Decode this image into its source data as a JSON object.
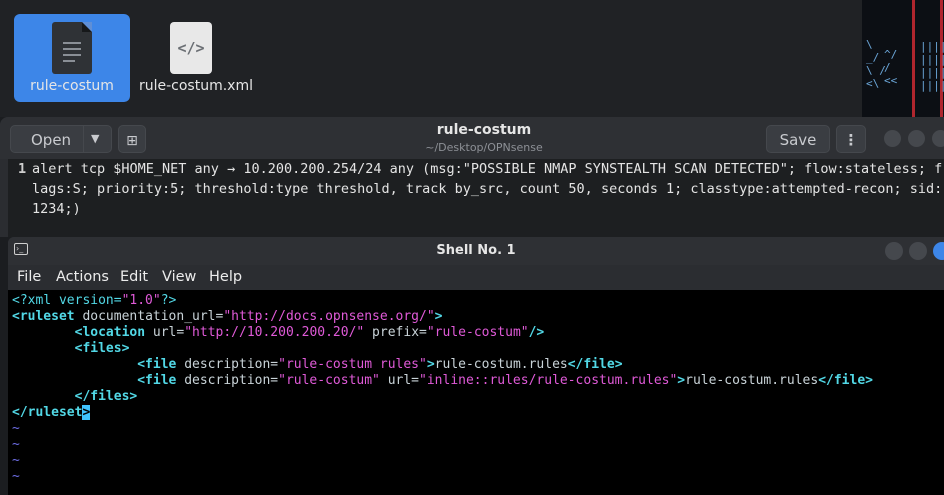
{
  "file_manager": {
    "files": [
      {
        "name": "rule-costum",
        "icon": "text-document-icon",
        "selected": true
      },
      {
        "name": "rule-costum.xml",
        "icon": "xml-code-icon",
        "selected": false
      }
    ]
  },
  "editor": {
    "open_label": "Open",
    "title": "rule-costum",
    "subtitle": "~/Desktop/OPNsense",
    "save_label": "Save",
    "line_number": "1",
    "content": "alert tcp $HOME_NET any → 10.200.200.254/24 any (msg:\"POSSIBLE NMAP SYNSTEALTH SCAN DETECTED\"; flow:stateless; flags:S; priority:5; threshold:type threshold, track by_src, count 50, seconds 1; classtype:attempted-recon; sid: 1234;)"
  },
  "terminal": {
    "title": "Shell No. 1",
    "menu": [
      "File",
      "Actions",
      "Edit",
      "View",
      "Help"
    ],
    "xml": {
      "decl_open": "<?xml version=",
      "decl_version": "\"1.0\"",
      "decl_close": "?>",
      "ruleset_tag": "<ruleset",
      "ruleset_attr": " documentation_url=",
      "ruleset_url": "\"http://docs.opnsense.org/\"",
      "tag_end": ">",
      "location_tag": "<location",
      "location_url_attr": " url=",
      "location_url": "\"http://10.200.200.20/\"",
      "location_prefix_attr": " prefix=",
      "location_prefix": "\"rule-costum\"",
      "self_close": "/>",
      "files_open": "<files>",
      "file_tag": "<file",
      "description_attr": " description=",
      "file1_description": "\"rule-costum rules\"",
      "file1_text": "rule-costum.rules",
      "file_close": "</file>",
      "file2_description": "\"rule-costum\"",
      "file2_url_attr": " url=",
      "file2_url": "\"inline::rules/rule-costum.rules\"",
      "file2_text": "rule-costum.rules",
      "files_close": "</files>",
      "ruleset_close_tag": "</ruleset",
      "ruleset_close_end": ">",
      "empty_line_marker": "~"
    }
  },
  "colors": {
    "selection": "#3d86e8",
    "xml_tag": "#52d8e6",
    "xml_value": "#e05ad8",
    "vim_tilde": "#6e6ee6",
    "cursor": "#40c4ff"
  }
}
